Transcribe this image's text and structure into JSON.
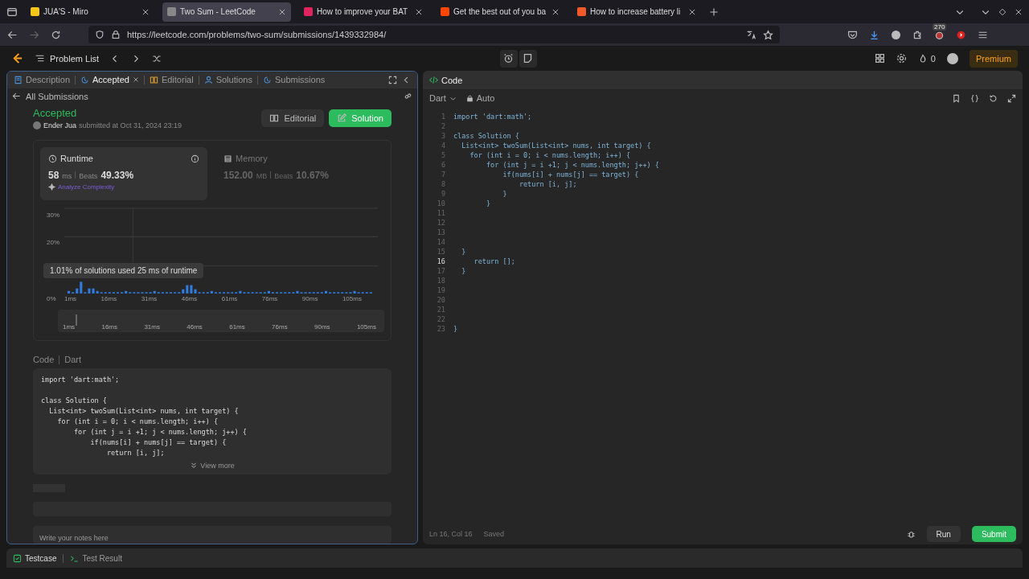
{
  "browser_tabs": [
    {
      "title": "JUA'S - Miro",
      "selected": false
    },
    {
      "title": "Two Sum - LeetCode",
      "selected": true
    },
    {
      "title": "How to improve your BAT",
      "selected": false
    },
    {
      "title": "Get the best out of you ba",
      "selected": false
    },
    {
      "title": "How to increase battery li",
      "selected": false
    }
  ],
  "address_bar": {
    "url": "https://leetcode.com/problems/two-sum/submissions/1439332984/"
  },
  "toolbar_badge": "270",
  "nav": {
    "problem_list": "Problem List",
    "streak": "0",
    "premium": "Premium"
  },
  "left_tabs": [
    {
      "label": "Description",
      "selected": false
    },
    {
      "label": "Accepted",
      "selected": true
    },
    {
      "label": "Editorial",
      "selected": false
    },
    {
      "label": "Solutions",
      "selected": false
    },
    {
      "label": "Submissions",
      "selected": false
    }
  ],
  "back_link": "All Submissions",
  "submission": {
    "status": "Accepted",
    "user": "Ender Jua",
    "submitted": "submitted at Oct 31, 2024 23:19",
    "editorial_button": "Editorial",
    "solution_button": "Solution"
  },
  "metrics": [
    {
      "title": "Runtime",
      "value": "58",
      "unit": "ms",
      "beats_label": "Beats",
      "beats": "49.33%",
      "selected": true
    },
    {
      "title": "Memory",
      "value": "152.00",
      "unit": "MB",
      "beats_label": "Beats",
      "beats": "10.67%",
      "selected": false
    }
  ],
  "analyze": "Analyze Complexity",
  "histogram": {
    "y_ticks": [
      "30%",
      "20%",
      "0%"
    ],
    "x_ticks": [
      "1ms",
      "16ms",
      "31ms",
      "46ms",
      "61ms",
      "76ms",
      "90ms",
      "105ms"
    ],
    "tooltip": "1.01% of solutions used 25 ms of runtime",
    "range_ticks": [
      "1ms",
      "16ms",
      "31ms",
      "46ms",
      "61ms",
      "76ms",
      "90ms",
      "105ms"
    ]
  },
  "code_section": {
    "label": "Code",
    "language": "Dart",
    "view_more": "View more",
    "lines": [
      {
        "kind": "code",
        "code": "import 'dart:math';"
      },
      {
        "kind": "blank"
      },
      {
        "kind": "code",
        "code": "class Solution {"
      },
      {
        "kind": "code",
        "code": "  List<int> twoSum(List<int> nums, int target) {"
      },
      {
        "kind": "code",
        "code": "    for (int i = 0; i < nums.length; i++) {"
      },
      {
        "kind": "code",
        "code": "        for (int j = i +1; j < nums.length; j++) {"
      },
      {
        "kind": "code",
        "code": "            if(nums[i] + nums[j] == target) {"
      },
      {
        "kind": "code",
        "code": "                return [i, j];"
      }
    ]
  },
  "notes_placeholder": "Write your notes here",
  "editor": {
    "title": "Code",
    "language": "Dart",
    "mode": "Auto",
    "lines": [
      {
        "number": "1",
        "code": "import 'dart:math';",
        "current": false
      },
      {
        "number": "2",
        "current": false
      },
      {
        "number": "3",
        "code": "class Solution {",
        "current": false
      },
      {
        "number": "4",
        "code": "  List<int> twoSum(List<int> nums, int target) {",
        "current": false
      },
      {
        "number": "5",
        "code": "    for (int i = 0; i < nums.length; i++) {",
        "current": false
      },
      {
        "number": "6",
        "code": "        for (int j = i +1; j < nums.length; j++) {",
        "current": false
      },
      {
        "number": "7",
        "code": "            if(nums[i] + nums[j] == target) {",
        "current": false
      },
      {
        "number": "8",
        "code": "                return [i, j];",
        "current": false
      },
      {
        "number": "9",
        "code": "            }",
        "current": false
      },
      {
        "number": "10",
        "code": "        }",
        "current": false
      },
      {
        "number": "11",
        "current": false
      },
      {
        "number": "12",
        "current": false
      },
      {
        "number": "13",
        "current": false
      },
      {
        "number": "14",
        "current": false
      },
      {
        "number": "15",
        "code": "  }",
        "current": false
      },
      {
        "number": "16",
        "code": "     return [];",
        "current": true
      },
      {
        "number": "17",
        "code": "  }",
        "current": false
      },
      {
        "number": "18",
        "current": false
      },
      {
        "number": "19",
        "current": false
      },
      {
        "number": "20",
        "current": false
      },
      {
        "number": "21",
        "current": false
      },
      {
        "number": "22",
        "current": false
      },
      {
        "number": "23",
        "code": "}",
        "current": false
      }
    ],
    "status": "Ln 16, Col 16",
    "saved": "Saved",
    "run": "Run",
    "submit": "Submit"
  },
  "bottom_tabs": [
    {
      "label": "Testcase",
      "selected": true
    },
    {
      "label": "Test Result",
      "selected": false
    }
  ]
}
